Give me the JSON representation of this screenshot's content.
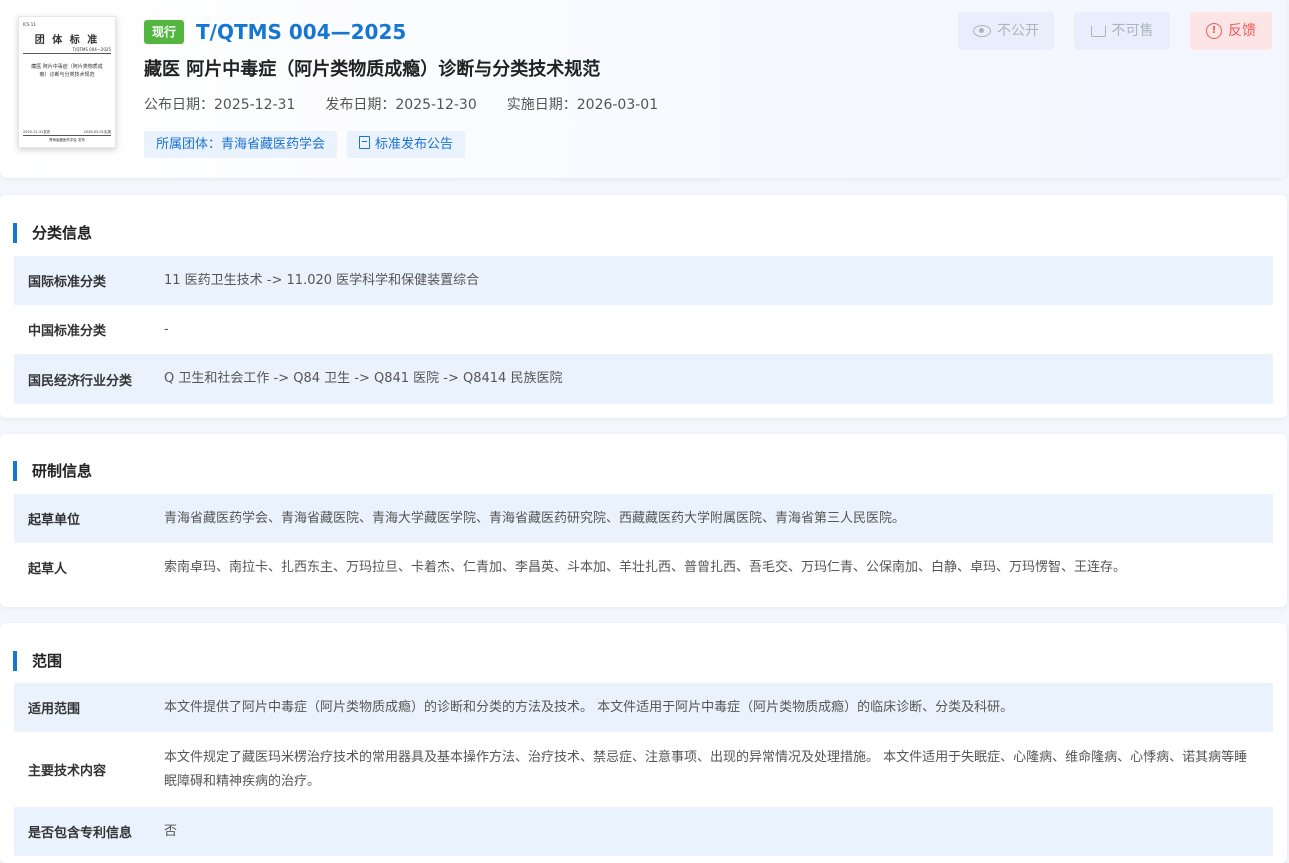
{
  "header": {
    "cover": {
      "ics": "ICS 11",
      "title": "团 体 标 准",
      "code": "T/QTMS 004—2025",
      "name": "藏医 阿片中毒症（阿片类物质成瘾）诊断与分类技术规范",
      "publish": "2025-12-31发布",
      "implement": "2026-03-01实施",
      "org": "青海省藏医药学会 发布"
    },
    "status": "现行",
    "code": "T/QTMS 004—2025",
    "title": "藏医 阿片中毒症（阿片类物质成瘾）诊断与分类技术规范",
    "dates": [
      {
        "label": "公布日期：",
        "value": "2025-12-31"
      },
      {
        "label": "发布日期：",
        "value": "2025-12-30"
      },
      {
        "label": "实施日期：",
        "value": "2026-03-01"
      }
    ],
    "org_tag": "所属团体：青海省藏医药学会",
    "notice_tag": "标准发布公告",
    "actions": {
      "private": "不公开",
      "nosale": "不可售",
      "feedback": "反馈"
    }
  },
  "sections": {
    "classification": {
      "title": "分类信息",
      "rows": [
        {
          "label": "国际标准分类",
          "value": "11 医药卫生技术 -> 11.020 医学科学和保健装置综合"
        },
        {
          "label": "中国标准分类",
          "value": "-"
        },
        {
          "label": "国民经济行业分类",
          "value": "Q 卫生和社会工作 -> Q84 卫生 -> Q841 医院 -> Q8414 民族医院"
        }
      ]
    },
    "development": {
      "title": "研制信息",
      "rows": [
        {
          "label": "起草单位",
          "value": "青海省藏医药学会、青海省藏医院、青海大学藏医学院、青海省藏医药研究院、西藏藏医药大学附属医院、青海省第三人民医院。"
        },
        {
          "label": "起草人",
          "value": "索南卓玛、南拉卡、扎西东主、万玛拉旦、卡着杰、仁青加、李昌英、斗本加、羊壮扎西、普曾扎西、吾毛交、万玛仁青、公保南加、白静、卓玛、万玛愣智、王连存。"
        }
      ]
    },
    "scope": {
      "title": "范围",
      "rows": [
        {
          "label": "适用范围",
          "value": "本文件提供了阿片中毒症（阿片类物质成瘾）的诊断和分类的方法及技术。 本文件适用于阿片中毒症（阿片类物质成瘾）的临床诊断、分类及科研。"
        },
        {
          "label": "主要技术内容",
          "value": "本文件规定了藏医玛米楞治疗技术的常用器具及基本操作方法、治疗技术、禁忌症、注意事项、出现的异常情况及处理措施。 本文件适用于失眠症、心隆病、维命隆病、心悸病、诺其病等睡眠障碍和精神疾病的治疗。"
        },
        {
          "label": "是否包含专利信息",
          "value": "否"
        }
      ]
    }
  },
  "colors": {
    "accent": "#1677d2",
    "status_green": "#52b640",
    "row_alt": "#eaf3fd",
    "feedback": "#ec5a5a"
  }
}
